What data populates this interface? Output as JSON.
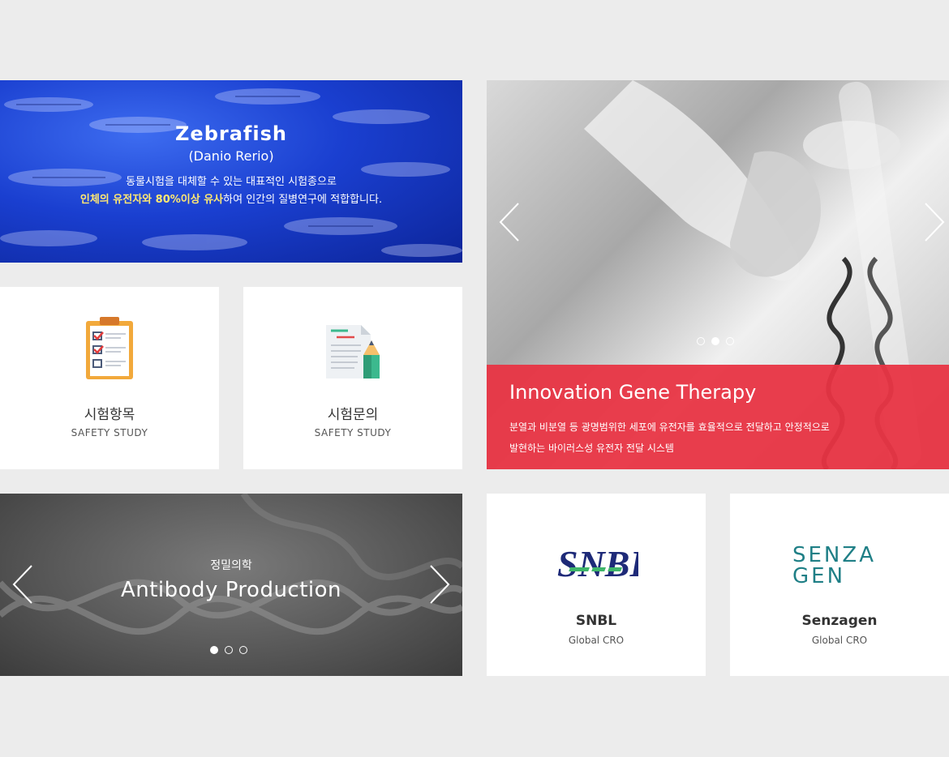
{
  "zebrafish": {
    "title": "Zebrafish",
    "subtitle": "(Danio Rerio)",
    "line1": "동물시험을 대체할 수 있는 대표적인 시험종으로",
    "line2_highlight": "인체의 유전자와 80%이상 유사",
    "line2_rest": "하여 인간의 질병연구에 적합합니다."
  },
  "cards": [
    {
      "title": "시험항목",
      "subtitle": "SAFETY STUDY",
      "icon": "clipboard-checklist-icon"
    },
    {
      "title": "시험문의",
      "subtitle": "SAFETY STUDY",
      "icon": "document-pencil-icon"
    }
  ],
  "gene_therapy": {
    "title": "Innovation Gene Therapy",
    "desc_line1": "분열과 비분열 등 광명범위한 세포에 유전자를 효율적으로 전달하고 안정적으로",
    "desc_line2": "발현하는 바이러스성 유전자 전달 시스템",
    "slide_active": 2,
    "slide_count": 3
  },
  "antibody": {
    "small": "정밀의학",
    "title": "Antibody Production",
    "slide_active": 1,
    "slide_count": 3
  },
  "partners": [
    {
      "name": "SNBL",
      "sub": "Global CRO",
      "logo": "SNBL"
    },
    {
      "name": "Senzagen",
      "sub": "Global CRO",
      "logo_line1": "SENZA",
      "logo_line2": "GEN"
    }
  ],
  "colors": {
    "background": "#ececec",
    "gene_red": "#e83443",
    "zebra_blue": "#1a3fd0",
    "highlight_yellow": "#ffe873",
    "snbl_navy": "#1e2a78",
    "senzagen_teal": "#1f7f86"
  }
}
